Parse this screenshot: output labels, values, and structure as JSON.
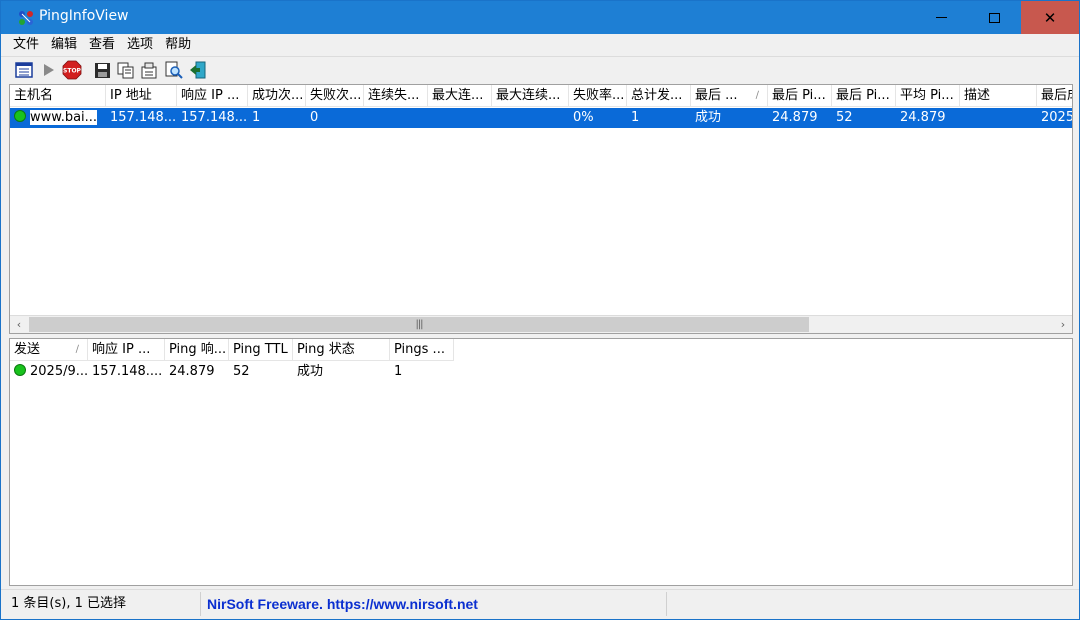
{
  "window": {
    "title": "PingInfoView"
  },
  "menu": [
    "文件",
    "编辑",
    "查看",
    "选项",
    "帮助"
  ],
  "toolbar": {
    "buttons": [
      "properties-icon",
      "play-icon",
      "stop-icon",
      "save-icon",
      "copy-icon",
      "options-icon",
      "find-icon",
      "exit-icon"
    ],
    "stop_label": "STOP"
  },
  "top_table": {
    "columns": [
      "主机名",
      "IP 地址",
      "响应 IP ...",
      "成功次...",
      "失败次...",
      "连续失...",
      "最大连...",
      "最大连续...",
      "失败率...",
      "总计发...",
      "最后 ...",
      "最后 Pi...",
      "最后 Pi...",
      "平均 Pi...",
      "描述",
      "最后成"
    ],
    "sort_column_index": 10,
    "rows": [
      {
        "selected": true,
        "status_color": "#19c21d",
        "cells": [
          "www.bai...",
          "157.148....",
          "157.148....",
          "1",
          "0",
          "",
          "",
          "",
          "0%",
          "1",
          "成功",
          "24.879",
          "52",
          "24.879",
          "",
          "2025"
        ]
      }
    ]
  },
  "bottom_table": {
    "columns": [
      "发送",
      "响应 IP ...",
      "Ping 响...",
      "Ping TTL",
      "Ping 状态",
      "Pings ..."
    ],
    "sort_column_index": 0,
    "rows": [
      {
        "status_color": "#19c21d",
        "cells": [
          "2025/9...",
          "157.148....",
          "24.879",
          "52",
          "成功",
          "1"
        ]
      }
    ]
  },
  "status": {
    "items": "1 条目(s), 1 已选择",
    "credit": "NirSoft Freeware. https://www.nirsoft.net",
    "extra": ""
  },
  "colors": {
    "titlebar": "#1e7fd4",
    "selection": "#0a6ad8",
    "close_button": "#c8584e",
    "link": "#0b2fd0"
  }
}
